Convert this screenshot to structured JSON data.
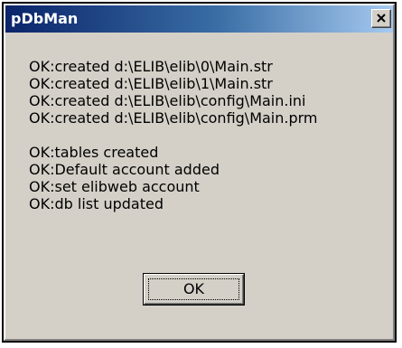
{
  "window": {
    "title": "pDbMan",
    "close_icon": "close-icon",
    "colors": {
      "titlebar_start": "#0a246a",
      "titlebar_end": "#a6caf0",
      "face": "#d4d0c8"
    }
  },
  "messages": {
    "group1": [
      "OK:created d:\\ELIB\\elib\\0\\Main.str",
      "OK:created d:\\ELIB\\elib\\1\\Main.str",
      "OK:created d:\\ELIB\\elib\\config\\Main.ini",
      "OK:created d:\\ELIB\\elib\\config\\Main.prm"
    ],
    "group2": [
      "OK:tables created",
      "OK:Default account added",
      "OK:set elibweb account",
      "OK:db list updated"
    ]
  },
  "buttons": {
    "ok_label": "OK"
  }
}
